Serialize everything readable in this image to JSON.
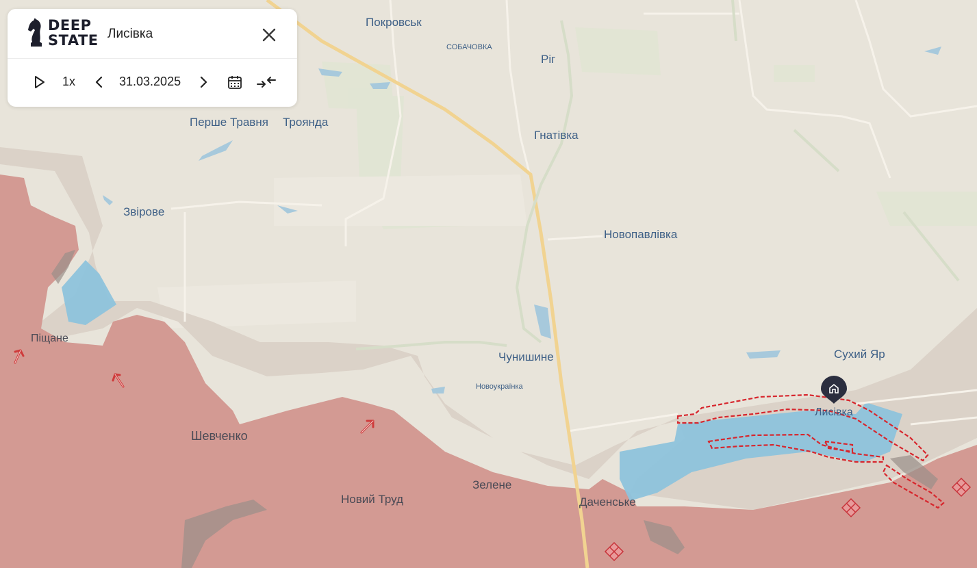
{
  "panel": {
    "logo_text": [
      "DEEP",
      "STATE"
    ],
    "title": "Лисівка",
    "speed": "1x",
    "date": "31.03.2025",
    "icons": [
      "play-icon",
      "chevron-left-icon",
      "chevron-right-icon",
      "calendar-icon",
      "compare-icon",
      "close-icon"
    ]
  },
  "map": {
    "colors": {
      "background": "#e8e4da",
      "occupied": "#d39a93",
      "grey_zone": "#dcd3c9",
      "liberated": "#8ec3dc",
      "road": "#f0cf8c",
      "water": "#9fc7dc",
      "fields": "#d8e3c8",
      "marker": "#2b2e3f",
      "outline": "#d7262d"
    },
    "places": [
      {
        "name": "Покровськ"
      },
      {
        "name": "СОБАЧОВКА"
      },
      {
        "name": "Ріг"
      },
      {
        "name": "Перше Травня"
      },
      {
        "name": "Троянда"
      },
      {
        "name": "Гнатівка"
      },
      {
        "name": "Звірове"
      },
      {
        "name": "Новопавлівка"
      },
      {
        "name": "Піщане"
      },
      {
        "name": "Чунишине"
      },
      {
        "name": "Новоукраїнка"
      },
      {
        "name": "Сухий Яр"
      },
      {
        "name": "Лисівка"
      },
      {
        "name": "Шевченко"
      },
      {
        "name": "Зелене"
      },
      {
        "name": "Новий Труд"
      },
      {
        "name": "Даченське"
      }
    ]
  }
}
